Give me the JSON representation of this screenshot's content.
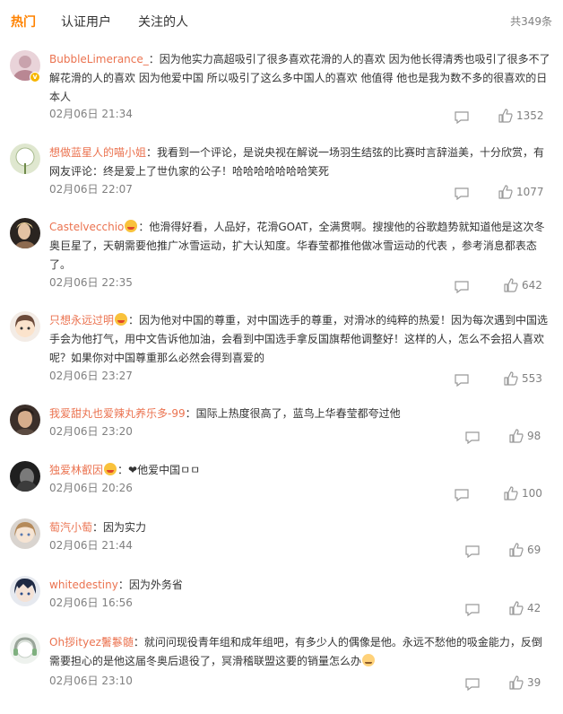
{
  "tabs": [
    {
      "label": "热门",
      "active": true
    },
    {
      "label": "认证用户",
      "active": false
    },
    {
      "label": "关注的人",
      "active": false
    }
  ],
  "total": "共349条",
  "comments": [
    {
      "user": "BubbleLimerance_",
      "text": "：因为他实力高超吸引了很多喜欢花滑的人的喜欢 因为他长得清秀也吸引了很多不了解花滑的人的喜欢 因为他爱中国 所以吸引了这么多中国人的喜欢 他值得 他也是我为数不多的很喜欢的日本人",
      "time": "02月06日 21:34",
      "likes": "1352",
      "avatar_icon": "avatar-pink-icon",
      "badge": "v"
    },
    {
      "user": "想做蓝星人的喵小姐",
      "text": "：我看到一个评论，是说央视在解说一场羽生结弦的比赛时言辞溢美，十分欣赏，有网友评论：终是爱上了世仇家的公子！哈哈哈哈哈哈哈笑死",
      "time": "02月06日 22:07",
      "likes": "1077",
      "avatar_icon": "avatar-dandelion-icon"
    },
    {
      "user": "Castelvecchio",
      "text": "：他滑得好看，人品好，花滑GOAT，全满贯啊。搜搜他的谷歌趋势就知道他是这次冬奥巨星了，天朝需要他推广冰雪运动，扩大认知度。华春莹都推他做冰雪运动的代表 ，参考消息都表态了。",
      "time": "02月06日 22:35",
      "likes": "642",
      "avatar_icon": "avatar-portrait-icon",
      "emoji": "smile-emoji-icon"
    },
    {
      "user": "只想永远过明",
      "text": "：因为他对中国的尊重，对中国选手的尊重，对滑冰的纯粹的热爱！因为每次遇到中国选手会为他打气，用中文告诉他加油，会看到中国选手拿反国旗帮他调整好！这样的人，怎么不会招人喜欢呢？如果你对中国尊重那么必然会得到喜爱的",
      "time": "02月06日 23:27",
      "likes": "553",
      "avatar_icon": "avatar-cartoon-girl-icon",
      "emoji": "smile-emoji-icon"
    },
    {
      "user": "我爱甜丸也爱辣丸养乐多-99",
      "text": "：国际上热度很高了，蓝鸟上华春莹都夸过他",
      "time": "02月06日 23:20",
      "likes": "98",
      "avatar_icon": "avatar-man-icon"
    },
    {
      "user": "独爱林叡因",
      "text": "：❤他爱中国ㅁㅁ",
      "time": "02月06日 20:26",
      "likes": "100",
      "avatar_icon": "avatar-dark-icon",
      "emoji": "smile-emoji-icon"
    },
    {
      "user": "萄汽小萄",
      "text": "：因为实力",
      "time": "02月06日 21:44",
      "likes": "69",
      "avatar_icon": "avatar-anime-icon"
    },
    {
      "user": "whitedestiny",
      "text": "：因为外务省",
      "time": "02月06日 16:56",
      "likes": "42",
      "avatar_icon": "avatar-anime-boy-icon"
    },
    {
      "user": "Oh拶ityez鬐鬖髄",
      "text": "：就问问现役青年组和成年组吧，有多少人的偶像是他。永远不愁他的吸金能力，反倒需要担心的是他这届冬奥后退役了，冥滑稽联盟这要的销量怎么办",
      "time": "02月06日 23:10",
      "likes": "39",
      "avatar_icon": "avatar-headphones-icon",
      "trail_emoji": "fox-emoji-icon"
    }
  ],
  "colors": {
    "accent": "#ff8200",
    "username": "#eb7350",
    "meta": "#808080"
  }
}
